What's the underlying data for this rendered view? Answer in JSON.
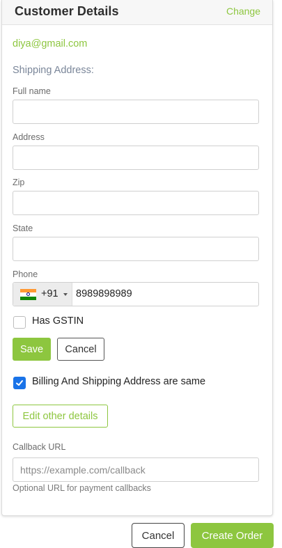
{
  "header": {
    "title": "Customer Details",
    "change_label": "Change"
  },
  "customer": {
    "email": "diya@gmail.com"
  },
  "shipping": {
    "section_title": "Shipping Address:",
    "full_name_label": "Full name",
    "full_name_value": "",
    "address_label": "Address",
    "address_value": "",
    "zip_label": "Zip",
    "zip_value": "",
    "state_label": "State",
    "state_value": "",
    "phone_label": "Phone",
    "phone_country_flag": "india-flag-icon",
    "phone_dial_code": "+91",
    "phone_value": "8989898989",
    "gstin_label": "Has GSTIN",
    "gstin_checked": false
  },
  "actions": {
    "save_label": "Save",
    "cancel_label": "Cancel"
  },
  "billing": {
    "same_label": "Billing And Shipping Address are same",
    "same_checked": true
  },
  "edit_other_label": "Edit other details",
  "callback": {
    "label": "Callback URL",
    "placeholder": "https://example.com/callback",
    "value": "",
    "helper": "Optional URL for payment callbacks"
  },
  "footer": {
    "cancel_label": "Cancel",
    "create_label": "Create Order"
  },
  "colors": {
    "accent": "#8dc63f",
    "checkbox_checked": "#1a73e8"
  }
}
